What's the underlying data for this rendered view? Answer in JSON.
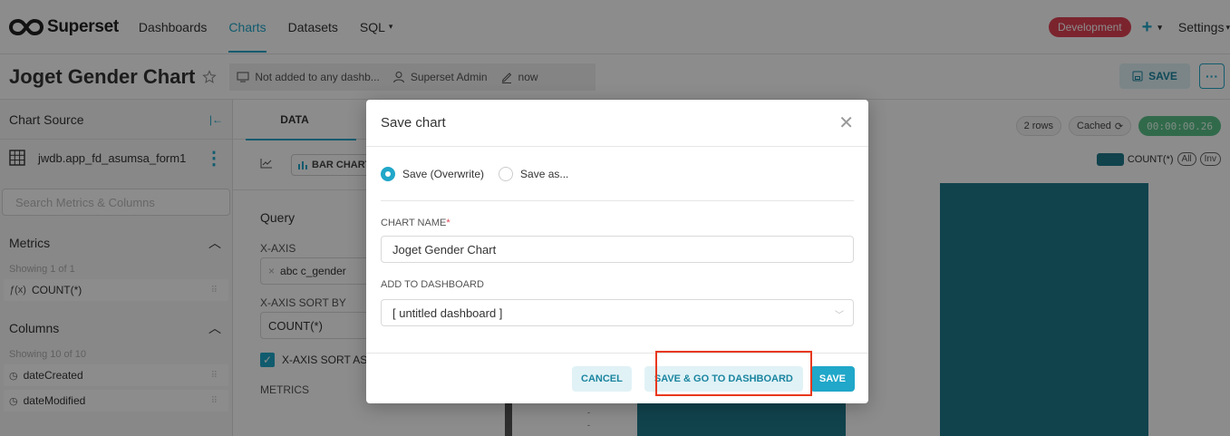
{
  "app": {
    "brand": "Superset",
    "nav": [
      "Dashboards",
      "Charts",
      "Datasets",
      "SQL"
    ],
    "env_badge": "Development",
    "plus": "+",
    "settings": "Settings"
  },
  "header": {
    "title": "Joget Gender Chart",
    "dashboard_meta": "Not added to any dashb...",
    "owner": "Superset Admin",
    "modified": "now",
    "save_label": "SAVE",
    "more_label": "···"
  },
  "datasource": {
    "heading": "Chart Source",
    "name": "jwdb.app_fd_asumsa_form1",
    "search_placeholder": "Search Metrics & Columns",
    "metrics_label": "Metrics",
    "metrics_showing": "Showing 1 of 1",
    "metric_item": "COUNT(*)",
    "columns_label": "Columns",
    "columns_showing": "Showing 10 of 10",
    "columns": [
      "dateCreated",
      "dateModified"
    ]
  },
  "controls": {
    "tab_data": "DATA",
    "viz_type": "BAR CHART",
    "query_label": "Query",
    "xaxis_label": "X-AXIS",
    "xaxis_value": "abc  c_gender",
    "xaxis_sort_label": "X-AXIS SORT BY",
    "xaxis_sort_value": "COUNT(*)",
    "sort_asc_label": "X-AXIS SORT ASC",
    "metrics_label": "METRICS"
  },
  "chart": {
    "rows": "2 rows",
    "cached": "Cached",
    "timer": "00:00:00.26",
    "legend": "COUNT(*)",
    "legend_all": "All",
    "legend_inv": "Inv",
    "bar_color": "#1f7a8c"
  },
  "modal": {
    "title": "Save chart",
    "radio_overwrite": "Save (Overwrite)",
    "radio_saveas": "Save as...",
    "chart_name_label": "CHART NAME",
    "chart_name_value": "Joget Gender Chart",
    "dashboard_label": "ADD TO DASHBOARD",
    "dashboard_value": "[ untitled dashboard ]",
    "cancel": "CANCEL",
    "save_go": "SAVE & GO TO DASHBOARD",
    "save": "SAVE"
  }
}
